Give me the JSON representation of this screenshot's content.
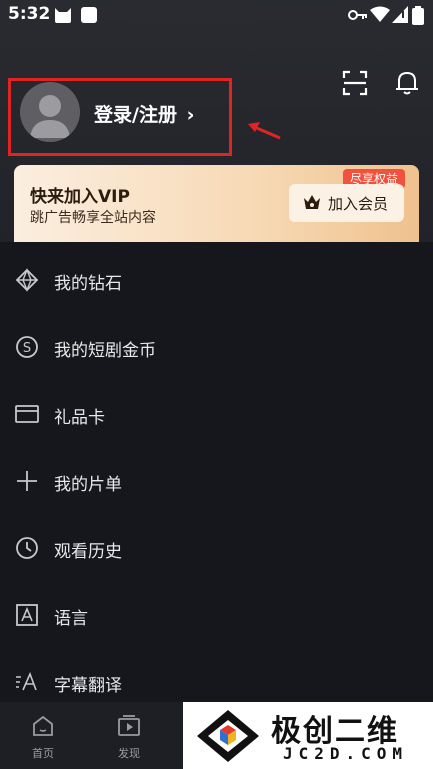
{
  "status_bar": {
    "time": "5:32"
  },
  "header": {
    "login_label": "登录/注册",
    "login_chevron": "›"
  },
  "vip": {
    "title": "快来加入VIP",
    "subtitle": "跳广告畅享全站内容",
    "badge": "尽享权益",
    "button_label": "加入会员"
  },
  "menu": [
    {
      "label": "我的钻石",
      "icon": "diamond-icon"
    },
    {
      "label": "我的短剧金币",
      "icon": "coin-icon"
    },
    {
      "label": "礼品卡",
      "icon": "card-icon"
    },
    {
      "label": "我的片单",
      "icon": "plus-icon"
    },
    {
      "label": "观看历史",
      "icon": "clock-icon"
    },
    {
      "label": "语言",
      "icon": "language-icon"
    },
    {
      "label": "字幕翻译",
      "icon": "subtitle-icon"
    }
  ],
  "bottom_nav": [
    {
      "label": "首页",
      "icon": "home-icon"
    },
    {
      "label": "发现",
      "icon": "discover-icon"
    }
  ],
  "watermark": {
    "text": "极创二维",
    "url": "JC2D.COM"
  },
  "colors": {
    "annotation": "#e02424",
    "vip_badge": "#f2513d",
    "background": "#16171c"
  }
}
